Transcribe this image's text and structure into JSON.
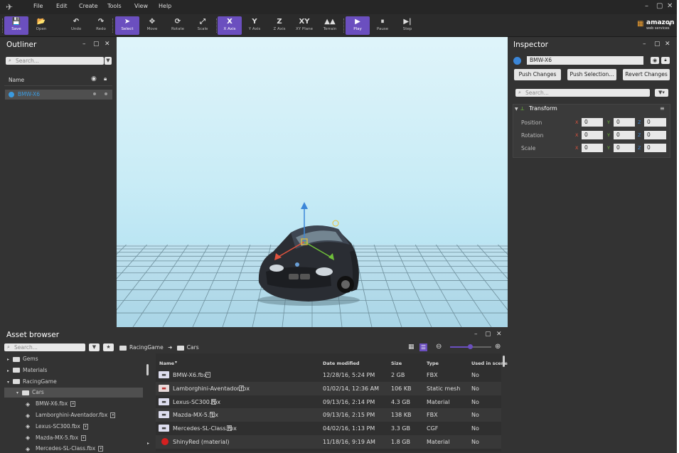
{
  "menu": [
    "File",
    "Edit",
    "Create",
    "Tools",
    "View",
    "Help"
  ],
  "toolbar": {
    "tools": [
      {
        "label": "Save",
        "icon": "💾",
        "active": true
      },
      {
        "label": "Open",
        "icon": "📂",
        "active": false
      },
      {
        "label": "Undo",
        "icon": "↶",
        "active": false
      },
      {
        "label": "Redo",
        "icon": "↷",
        "active": false
      },
      {
        "label": "Select",
        "icon": "➤",
        "active": true
      },
      {
        "label": "Move",
        "icon": "✥",
        "active": false
      },
      {
        "label": "Rotate",
        "icon": "⟳",
        "active": false
      },
      {
        "label": "Scale",
        "icon": "⤢",
        "active": false
      },
      {
        "label": "X Axis",
        "icon": "X",
        "active": true
      },
      {
        "label": "Y Axis",
        "icon": "Y",
        "active": false
      },
      {
        "label": "Z Axis",
        "icon": "Z",
        "active": false
      },
      {
        "label": "XY Plane",
        "icon": "XY",
        "active": false
      },
      {
        "label": "Terrain",
        "icon": "▲▲",
        "active": false
      },
      {
        "label": "Play",
        "icon": "▶",
        "active": true
      },
      {
        "label": "Pause",
        "icon": "⏸",
        "active": false
      },
      {
        "label": "Step",
        "icon": "▶|",
        "active": false
      }
    ],
    "brand": "amazon",
    "brand_sub": "web services"
  },
  "outliner": {
    "title": "Outliner",
    "search_placeholder": "Search...",
    "column_name": "Name",
    "items": [
      {
        "label": "BMW-X6",
        "color": "#3b9be0"
      }
    ]
  },
  "inspector": {
    "title": "Inspector",
    "entity_name": "BMW-X6",
    "buttons": [
      "Push Changes",
      "Push Selection...",
      "Revert Changes"
    ],
    "search_placeholder": "Search...",
    "component": "Transform",
    "rows": [
      {
        "label": "Position",
        "values": [
          "0",
          "0",
          "0"
        ]
      },
      {
        "label": "Rotation",
        "values": [
          "0",
          "0",
          "0"
        ]
      },
      {
        "label": "Scale",
        "values": [
          "0",
          "0",
          "0"
        ]
      }
    ],
    "axes": [
      "X",
      "Y",
      "Z"
    ],
    "axis_colors": [
      "#e0533e",
      "#6fbf3a",
      "#3b86d8"
    ]
  },
  "asset_browser": {
    "title": "Asset browser",
    "search_placeholder": "Search...",
    "breadcrumb": [
      "RacingGame",
      "Cars"
    ],
    "tree": [
      {
        "label": "Gems",
        "type": "folder",
        "depth": 0,
        "expanded": false
      },
      {
        "label": "Materials",
        "type": "folder",
        "depth": 0,
        "expanded": false
      },
      {
        "label": "RacingGame",
        "type": "folder",
        "depth": 0,
        "expanded": true
      },
      {
        "label": "Cars",
        "type": "folder",
        "depth": 1,
        "expanded": true,
        "selected": true
      },
      {
        "label": "BMW-X6.fbx",
        "type": "file",
        "depth": 2
      },
      {
        "label": "Lamborghini-Aventador.fbx",
        "type": "file",
        "depth": 2
      },
      {
        "label": "Lexus-SC300.fbx",
        "type": "file",
        "depth": 2
      },
      {
        "label": "Mazda-MX-5.fbx",
        "type": "file",
        "depth": 2
      },
      {
        "label": "Mercedes-SL-Class.fbx",
        "type": "file",
        "depth": 2
      }
    ],
    "columns": [
      "Name",
      "Date modified",
      "Size",
      "Type",
      "Used in scene"
    ],
    "files": [
      {
        "name": "BMW-X6.fbx",
        "date": "12/28/16, 5:24 PM",
        "size": "2 GB",
        "type": "FBX",
        "used": "No",
        "thumb": "car"
      },
      {
        "name": "Lamborghini-Aventador.fbx",
        "date": "01/02/14, 12:36 AM",
        "size": "106 KB",
        "type": "Static mesh",
        "used": "No",
        "thumb": "car-red"
      },
      {
        "name": "Lexus-SC300.fbx",
        "date": "09/13/16, 2:14 PM",
        "size": "4.3 GB",
        "type": "Material",
        "used": "No",
        "thumb": "car"
      },
      {
        "name": "Mazda-MX-5.fbx",
        "date": "09/13/16, 2:15 PM",
        "size": "138 KB",
        "type": "FBX",
        "used": "No",
        "thumb": "car"
      },
      {
        "name": "Mercedes-SL-Class.fbx",
        "date": "04/02/16, 1:13 PM",
        "size": "3.3 GB",
        "type": "CGF",
        "used": "No",
        "thumb": "car"
      },
      {
        "name": "ShinyRed (material)",
        "date": "11/18/16, 9:19 AM",
        "size": "1.8 GB",
        "type": "Material",
        "used": "No",
        "thumb": "sphere"
      }
    ]
  }
}
